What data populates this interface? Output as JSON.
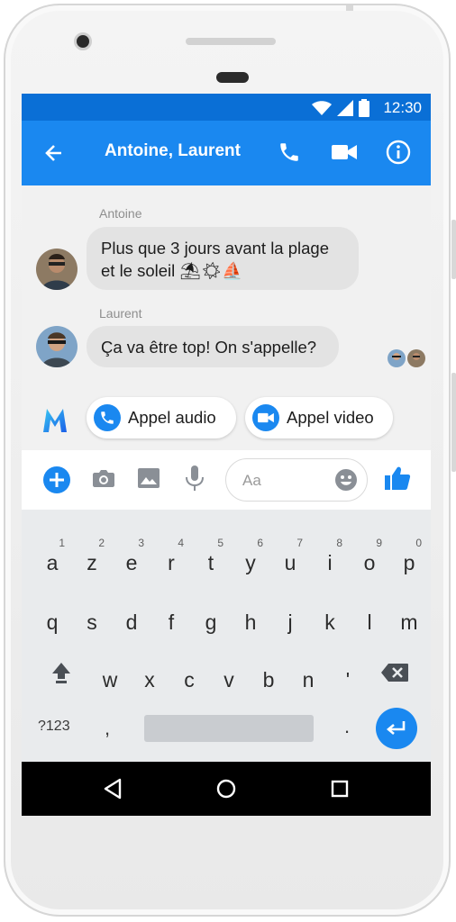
{
  "status_bar": {
    "time": "12:30"
  },
  "header": {
    "title": "Antoine, Laurent"
  },
  "messages": [
    {
      "sender": "Antoine",
      "line1": "Plus que 3 jours avant la plage",
      "line2": "et le soleil",
      "emojis": "⛱☀⛵"
    },
    {
      "sender": "Laurent",
      "text": "Ça va être top! On s'appelle?"
    }
  ],
  "suggestions": [
    {
      "label": "Appel audio",
      "icon": "phone-icon"
    },
    {
      "label": "Appel video",
      "icon": "video-camera-icon"
    }
  ],
  "composer": {
    "placeholder": "Aa"
  },
  "keyboard": {
    "row1": [
      {
        "ch": "a",
        "num": "1"
      },
      {
        "ch": "z",
        "num": "2"
      },
      {
        "ch": "e",
        "num": "3"
      },
      {
        "ch": "r",
        "num": "4"
      },
      {
        "ch": "t",
        "num": "5"
      },
      {
        "ch": "y",
        "num": "6"
      },
      {
        "ch": "u",
        "num": "7"
      },
      {
        "ch": "i",
        "num": "8"
      },
      {
        "ch": "o",
        "num": "9"
      },
      {
        "ch": "p",
        "num": "0"
      }
    ],
    "row2": [
      "q",
      "s",
      "d",
      "f",
      "g",
      "h",
      "j",
      "k",
      "l",
      "m"
    ],
    "row3": [
      "w",
      "x",
      "c",
      "v",
      "b",
      "n",
      "'"
    ],
    "sym_label": "?123",
    "comma": ",",
    "dot": "."
  },
  "colors": {
    "app_bar": "#1a88f0",
    "status_bar": "#0a6fd6",
    "bubble": "#e3e3e3"
  }
}
